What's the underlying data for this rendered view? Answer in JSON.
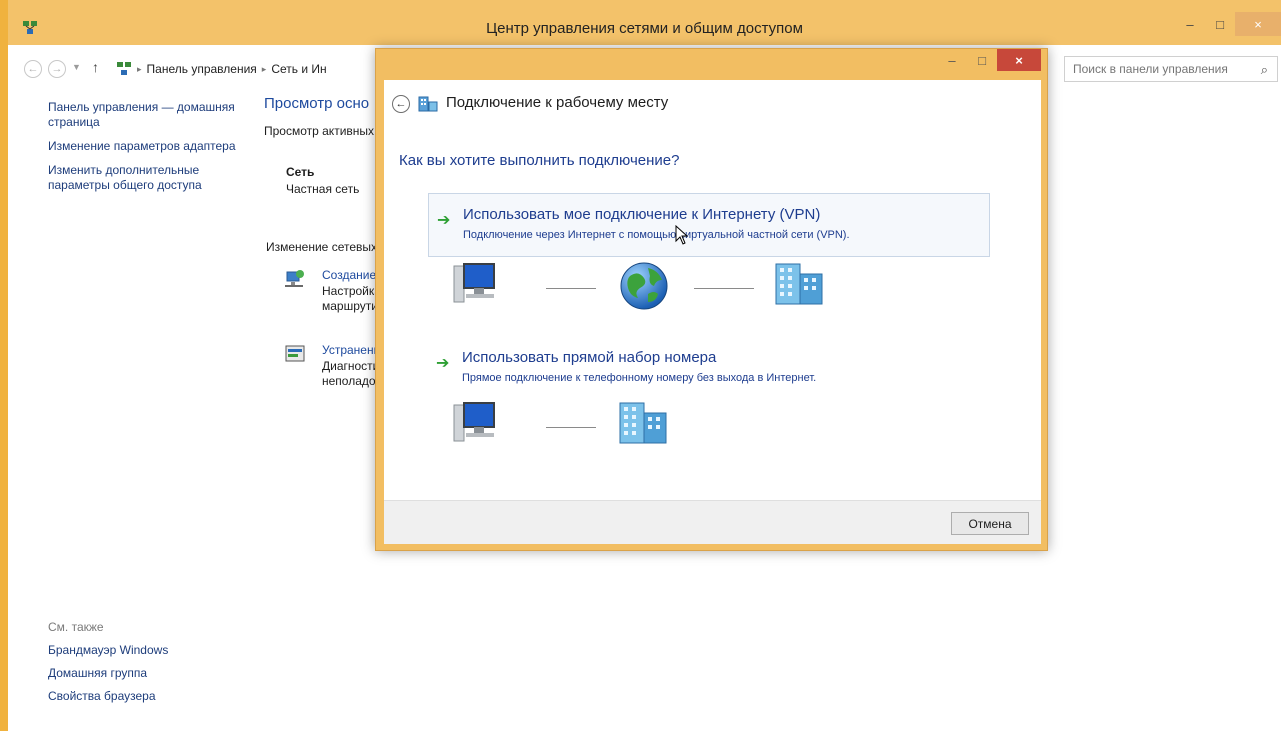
{
  "window": {
    "title": "Центр управления сетями и общим доступом",
    "minimize_glyph": "–",
    "maximize_glyph": "□",
    "close_glyph": "×"
  },
  "addressbar": {
    "back_glyph": "←",
    "forward_glyph": "→",
    "recent_glyph": "▼",
    "up_glyph": "↑",
    "breadcrumb": [
      "Панель управления",
      "Сеть и Ин"
    ],
    "separator_glyph": "▸",
    "search_placeholder": "Поиск в панели управления",
    "search_icon": "search-icon"
  },
  "left_pane": {
    "links": [
      "Панель управления — домашняя страница",
      "Изменение параметров адаптера",
      "Изменить дополнительные параметры общего доступа"
    ],
    "see_also_title": "См. также",
    "see_also_links": [
      "Брандмауэр Windows",
      "Домашняя группа",
      "Свойства браузера"
    ]
  },
  "content": {
    "title": "Просмотр осно",
    "subtitle": "Просмотр активных",
    "network_name": "Сеть",
    "network_type": "Частная сеть",
    "change_title": "Изменение сетевых",
    "tasks": [
      {
        "link": "Создание",
        "desc_line1": "Настройка",
        "desc_line2": "маршрути"
      },
      {
        "link": "Устранени",
        "desc_line1": "Диагности",
        "desc_line2": "неполадок"
      }
    ]
  },
  "dialog": {
    "back_glyph": "←",
    "title": "Подключение к рабочему месту",
    "minimize_glyph": "–",
    "maximize_glyph": "□",
    "close_glyph": "×",
    "question": "Как вы хотите выполнить подключение?",
    "arrow_glyph": "➔",
    "options": [
      {
        "title": "Использовать мое подключение к Интернету (VPN)",
        "desc": "Подключение через Интернет с помощью виртуальной частной сети (VPN)."
      },
      {
        "title": "Использовать прямой набор номера",
        "desc": "Прямое подключение к телефонному номеру без выхода в Интернет."
      }
    ],
    "cancel_label": "Отмена"
  },
  "colors": {
    "accent": "#f2be62",
    "link": "#1e4a9e",
    "green_arrow": "#2ea034"
  }
}
